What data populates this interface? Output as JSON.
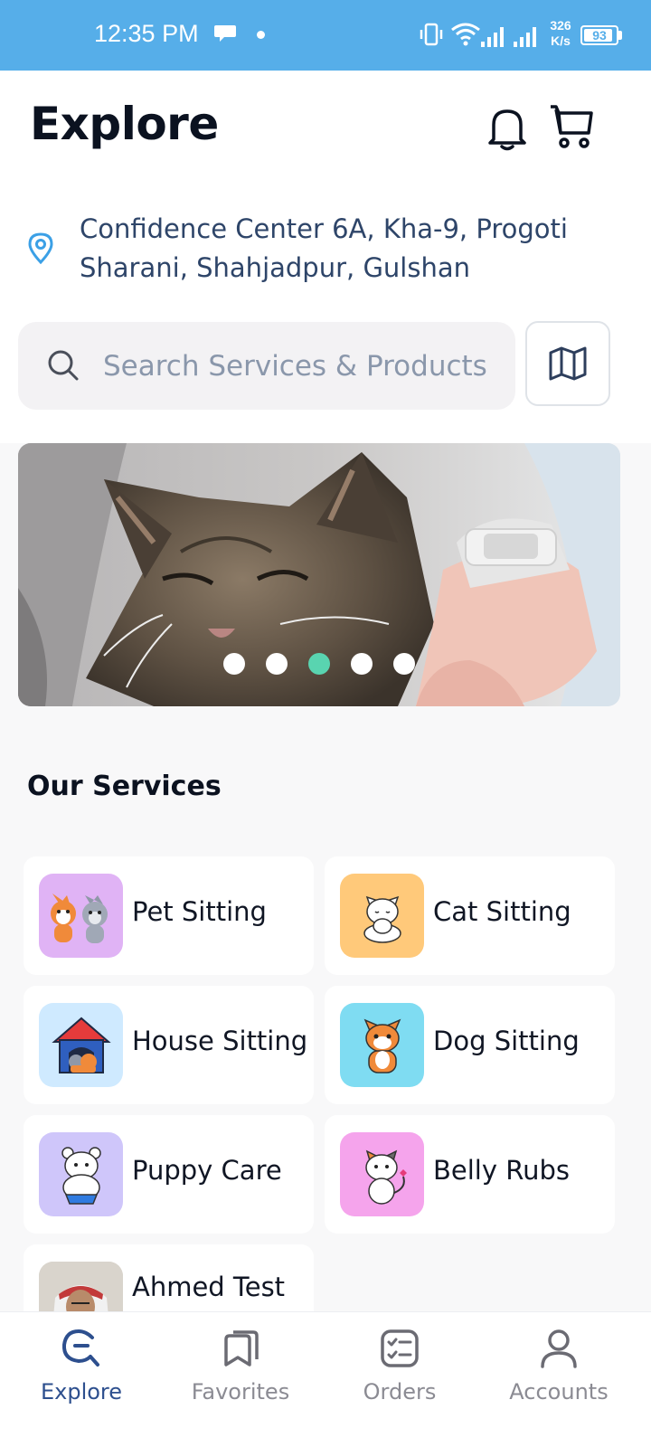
{
  "status_bar": {
    "time": "12:35 PM",
    "speed_value": "326",
    "speed_unit": "K/s",
    "battery": "93",
    "battery_level": 0.93
  },
  "header": {
    "title": "Explore",
    "icons": [
      "bell-icon",
      "cart-icon"
    ]
  },
  "location": {
    "address": "Confidence Center 6A, Kha-9, Progoti Sharani, Shahjadpur, Gulshan"
  },
  "search": {
    "placeholder": "Search Services & Products"
  },
  "banner": {
    "slide_count": 5,
    "active_slide": 3
  },
  "services": {
    "title": "Our Services",
    "items": [
      {
        "label": "Pet Sitting",
        "thumb_color": "#e0b3f5"
      },
      {
        "label": "Cat Sitting",
        "thumb_color": "#ffc97a"
      },
      {
        "label": "House Sitting",
        "thumb_color": "#cfeaff"
      },
      {
        "label": "Dog Sitting",
        "thumb_color": "#7fdcf2"
      },
      {
        "label": "Puppy Care",
        "thumb_color": "#cfc6fa"
      },
      {
        "label": "Belly Rubs",
        "thumb_color": "#f5a4ec"
      },
      {
        "label": "Ahmed Test",
        "thumb_color": "#d9d4cc"
      }
    ]
  },
  "nav": {
    "items": [
      {
        "label": "Explore",
        "active": true
      },
      {
        "label": "Favorites",
        "active": false
      },
      {
        "label": "Orders",
        "active": false
      },
      {
        "label": "Accounts",
        "active": false
      }
    ]
  },
  "colors": {
    "status_bar": "#56aee9",
    "accent": "#2d4f8e",
    "dot_active": "#59d4b0"
  }
}
